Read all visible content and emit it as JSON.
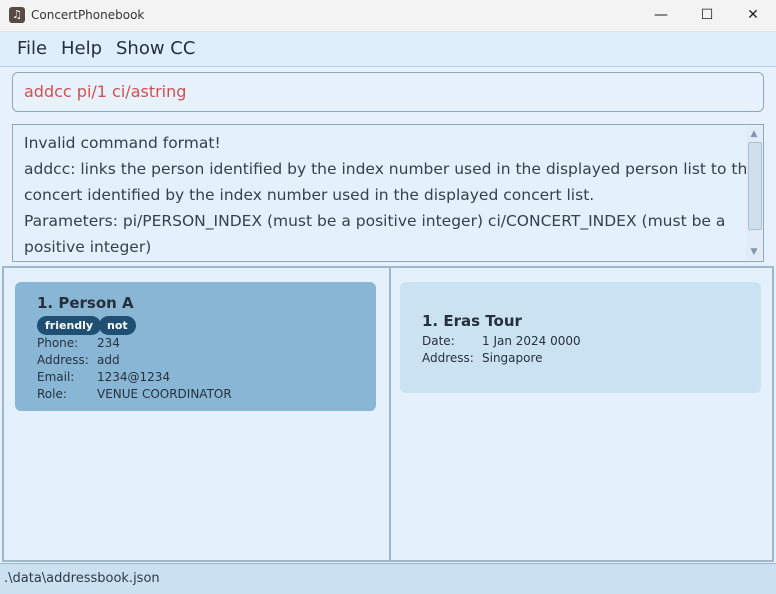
{
  "window": {
    "title": "ConcertPhonebook",
    "app_icon": "music-note-icon",
    "controls": {
      "minimize": "—",
      "maximize": "☐",
      "close": "✕"
    }
  },
  "menu": {
    "items": [
      "File",
      "Help",
      "Show CC"
    ]
  },
  "command_box": {
    "value": "addcc pi/1 ci/astring"
  },
  "result": {
    "lines": [
      "Invalid command format!",
      "addcc: links the person identified by the index number used in the displayed person list to the",
      "concert identified by the index number used in the displayed concert list.",
      "Parameters: pi/PERSON_INDEX (must be a positive integer) ci/CONCERT_INDEX (must be a",
      "positive integer)"
    ]
  },
  "person_list": [
    {
      "title": "1. Person A",
      "tags": [
        "friendly",
        "not"
      ],
      "fields": [
        {
          "label": "Phone:",
          "value": "234"
        },
        {
          "label": "Address:",
          "value": "add"
        },
        {
          "label": "Email:",
          "value": "1234@1234"
        },
        {
          "label": "Role:",
          "value": "VENUE COORDINATOR"
        }
      ]
    }
  ],
  "concert_list": [
    {
      "title": "1. Eras Tour",
      "fields": [
        {
          "label": "Date:",
          "value": "1 Jan 2024 0000"
        },
        {
          "label": "Address:",
          "value": "Singapore"
        }
      ]
    }
  ],
  "status_bar": {
    "path": ".\\data\\addressbook.json"
  },
  "colors": {
    "background": "#e6f1fb",
    "person_card": "#8ab6d6",
    "concert_card": "#cbe2f3",
    "tag": "#1f4f73",
    "command_error_text": "#d05050"
  }
}
